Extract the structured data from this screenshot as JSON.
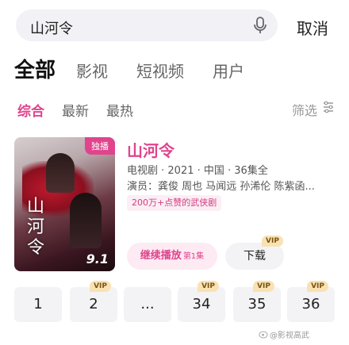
{
  "search": {
    "query": "山河令"
  },
  "header": {
    "cancel_label": "取消"
  },
  "main_tabs": [
    {
      "label": "全部",
      "active": true
    },
    {
      "label": "影视",
      "active": false
    },
    {
      "label": "短视频",
      "active": false
    },
    {
      "label": "用户",
      "active": false
    }
  ],
  "sub_tabs": [
    {
      "label": "综合",
      "active": true
    },
    {
      "label": "最新",
      "active": false
    },
    {
      "label": "最热",
      "active": false
    }
  ],
  "filter_label": "筛选",
  "result": {
    "badge": "独播",
    "poster_title": "山河令",
    "rating": "9.1",
    "title": "山河令",
    "meta": "电视剧 · 2021 · 中国 · 36集全",
    "cast": "演员：龚俊 周也 马闻远 孙浠伦 陈紫函...",
    "tag": "200万+点赞的武侠剧",
    "play_label": "继续播放",
    "play_episode": "第1集",
    "download_label": "下载",
    "download_vip": "VIP"
  },
  "episodes": [
    {
      "label": "1",
      "vip": ""
    },
    {
      "label": "2",
      "vip": "VIP"
    },
    {
      "label": "...",
      "vip": ""
    },
    {
      "label": "34",
      "vip": "VIP"
    },
    {
      "label": "35",
      "vip": "VIP"
    },
    {
      "label": "36",
      "vip": "VIP"
    }
  ],
  "watermark": "@影视高武",
  "colors": {
    "accent": "#e0448d",
    "vip_bg": "#f8e2b4",
    "chip_bg": "#f3f3f5"
  }
}
